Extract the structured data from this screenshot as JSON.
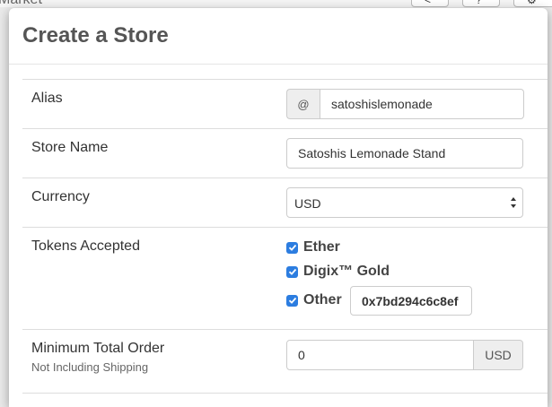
{
  "background": {
    "nav_title": "Market",
    "buttons": [
      "<",
      "?",
      "⚙"
    ]
  },
  "modal": {
    "title": "Create a Store"
  },
  "form": {
    "alias": {
      "label": "Alias",
      "prefix": "@",
      "value": "satoshislemonade"
    },
    "store_name": {
      "label": "Store Name",
      "value": "Satoshis Lemonade Stand"
    },
    "currency": {
      "label": "Currency",
      "selected": "USD"
    },
    "tokens": {
      "label": "Tokens Accepted",
      "items": [
        {
          "label": "Ether",
          "checked": true
        },
        {
          "label": "Digix™ Gold",
          "checked": true
        },
        {
          "label": "Other",
          "checked": true
        }
      ],
      "other_address": "0x7bd294c6c8ef"
    },
    "min_order": {
      "label": "Minimum Total Order",
      "sublabel": "Not Including Shipping",
      "value": "0",
      "suffix": "USD"
    }
  },
  "colors": {
    "checkbox": "#2c7de0",
    "addon_bg": "#eeeeee",
    "title": "#555555"
  },
  "icons": {
    "checkbox": "checkmark-icon",
    "select": "select-arrows-icon"
  }
}
